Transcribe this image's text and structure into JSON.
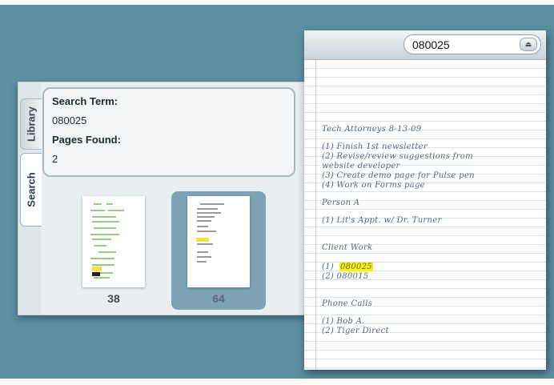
{
  "search_panel": {
    "tabs": [
      {
        "label": "Library"
      },
      {
        "label": "Search"
      }
    ],
    "search_term_label": "Search Term:",
    "search_term_value": "080025",
    "pages_found_label": "Pages Found:",
    "pages_found_value": "2",
    "thumbnails": [
      {
        "page": "38",
        "selected": false
      },
      {
        "page": "64",
        "selected": true
      }
    ]
  },
  "notebook": {
    "search_value": "080025",
    "search_button_icon": "eject-icon",
    "lines": [
      {
        "text": "Tech Attorneys      8-13-09"
      },
      {
        "text": "(1) Finish 1st newsletter"
      },
      {
        "text": "(2) Revise/review suggestions from"
      },
      {
        "text": "         website developer"
      },
      {
        "text": "(3) Create demo page for Pulse pen"
      },
      {
        "text": "(4) Work on Forms page"
      },
      {
        "text": "Person A"
      },
      {
        "text": "(1) Lit's Appt. w/ Dr. Turner"
      },
      {
        "text": "Client Work"
      },
      {
        "text": "080025",
        "highlight": true
      },
      {
        "text": "(2) 080015"
      },
      {
        "text": "Phone Calls"
      },
      {
        "text": "(1) Bob A."
      },
      {
        "text": "(2) Tiger Direct"
      }
    ]
  },
  "colors": {
    "background": "#5d8fa1",
    "highlight": "#f4ee2b",
    "selected_thumb": "#7ea3b4"
  }
}
